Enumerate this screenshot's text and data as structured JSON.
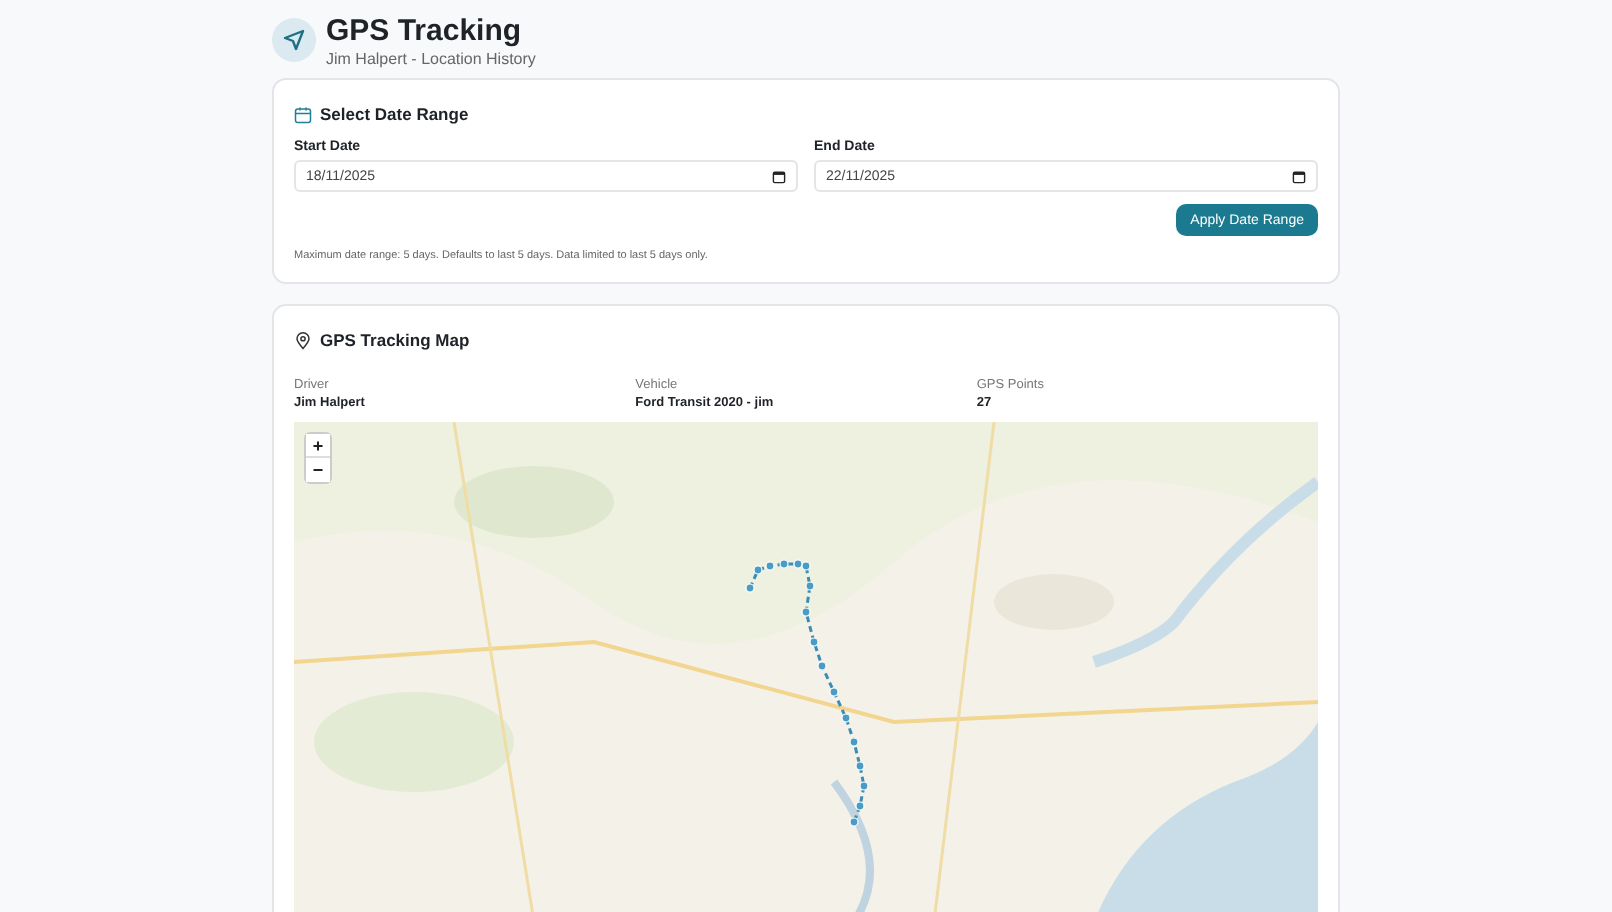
{
  "header": {
    "title": "GPS Tracking",
    "subtitle": "Jim Halpert - Location History"
  },
  "date_range": {
    "title": "Select Date Range",
    "fields": [
      {
        "label": "Start Date",
        "value": "18/11/2025"
      },
      {
        "label": "End Date",
        "value": "22/11/2025"
      }
    ],
    "button": "Apply Date Range",
    "note": "Maximum date range: 5 days. Defaults to last 5 days. Data limited to last 5 days only."
  },
  "map_card": {
    "title": "GPS Tracking Map",
    "stats": [
      {
        "label": "Driver",
        "value": "Jim Halpert"
      },
      {
        "label": "Vehicle",
        "value": "Ford Transit 2020 - jim"
      },
      {
        "label": "GPS Points",
        "value": "27"
      }
    ],
    "map": {
      "kind": "picture",
      "zoom_in": "+",
      "zoom_out": "−"
    }
  }
}
